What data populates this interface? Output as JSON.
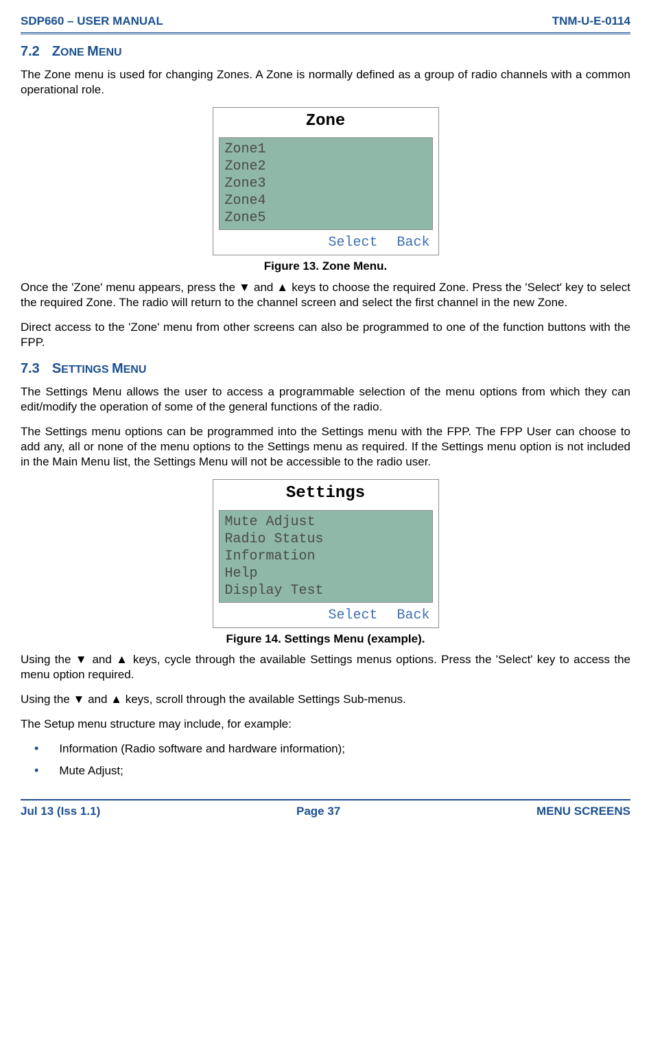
{
  "header": {
    "left": "SDP660 – USER MANUAL",
    "right": "TNM-U-E-0114"
  },
  "section_7_2": {
    "num": "7.2",
    "heading_part1": "Z",
    "heading_part2": "ONE ",
    "heading_part3": "M",
    "heading_part4": "ENU",
    "para1": "The Zone menu is used for changing Zones.  A Zone is normally defined as a group of radio channels with a common operational role.",
    "para2": "Once the 'Zone' menu appears, press the ▼ and ▲ keys to choose the required Zone.  Press the 'Select' key to select the required Zone.  The radio will return to the channel screen and select the first channel in the new Zone.",
    "para3": "Direct access to the 'Zone' menu from other screens can also be programmed to one of the function buttons with the FPP."
  },
  "figure13": {
    "title": "Zone",
    "items": [
      "Zone1",
      "Zone2",
      "Zone3",
      "Zone4",
      "Zone5"
    ],
    "select": "Select",
    "back": "Back",
    "caption": "Figure 13.  Zone Menu."
  },
  "section_7_3": {
    "num": "7.3",
    "heading_part1": "S",
    "heading_part2": "ETTINGS ",
    "heading_part3": "M",
    "heading_part4": "ENU",
    "para1": "The Settings Menu allows the user to access a programmable selection of the menu options from which they can edit/modify the operation of some of the general functions of the radio.",
    "para2": "The Settings menu options can be programmed into the Settings menu with the FPP.  The FPP User can choose to add any, all or none of the menu options to the Settings menu as required.  If the Settings menu option is not included in the Main Menu list, the Settings Menu will not be accessible to the radio user.",
    "para3": "Using the ▼ and ▲ keys, cycle through the available Settings menus options.  Press the 'Select' key to access the menu option required.",
    "para4": "Using the ▼ and ▲ keys, scroll through the available Settings Sub-menus.",
    "para5": "The Setup menu structure may include, for example:"
  },
  "figure14": {
    "title": "Settings",
    "items": [
      "Mute Adjust",
      "Radio Status",
      "Information",
      "Help",
      "Display Test"
    ],
    "select": "Select",
    "back": "Back",
    "caption": "Figure 14.  Settings Menu (example)."
  },
  "bullets": [
    "Information (Radio software and hardware information);",
    "Mute Adjust;"
  ],
  "footer": {
    "left": "Jul 13 (Iss 1.1)",
    "center": "Page 37",
    "right": "MENU SCREENS"
  }
}
